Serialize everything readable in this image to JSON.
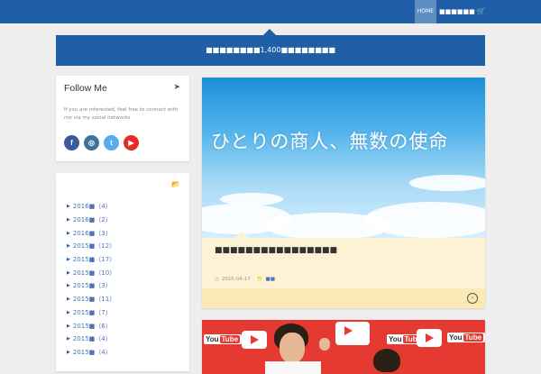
{
  "nav": {
    "home_label": "HOME",
    "other_label": "■■■■■■",
    "cart_icon": "cart-icon"
  },
  "banner": {
    "text": "■■■■■■■■1,400■■■■■■■■"
  },
  "follow": {
    "title": "Follow Me",
    "icon": "rocket-icon",
    "text": "If you are interested, feel free to connect with me via my social networks",
    "socials": [
      {
        "name": "facebook",
        "glyph": "f",
        "color": "#3b5998"
      },
      {
        "name": "instagram",
        "glyph": "◎",
        "color": "#3f729b"
      },
      {
        "name": "twitter",
        "glyph": "t",
        "color": "#55acee"
      },
      {
        "name": "youtube",
        "glyph": "▶",
        "color": "#e52d27"
      }
    ]
  },
  "archive": {
    "icon": "folder-open-icon",
    "items": [
      "2016■（4）",
      "2016■（2）",
      "2016■（3）",
      "2015■（12）",
      "2015■（17）",
      "2015■（10）",
      "2015■（3）",
      "2015■（11）",
      "2015■（7）",
      "2015■（6）",
      "2015■（4）",
      "2015■（4）"
    ]
  },
  "post": {
    "image_text": "ひとりの商人、無数の使命",
    "title": "■■■■■■■■■■■■■■■■",
    "date": "2016-04-17",
    "category": "■■",
    "more_icon": "chevron-right-circle-icon"
  },
  "post2": {
    "logo_text": "You",
    "logo_tube": "Tube"
  },
  "colors": {
    "header_blue": "#1f5fa8",
    "home_active": "#5f8ec2",
    "post_body": "#fdf3d4",
    "youtube_red": "#e43a32"
  }
}
